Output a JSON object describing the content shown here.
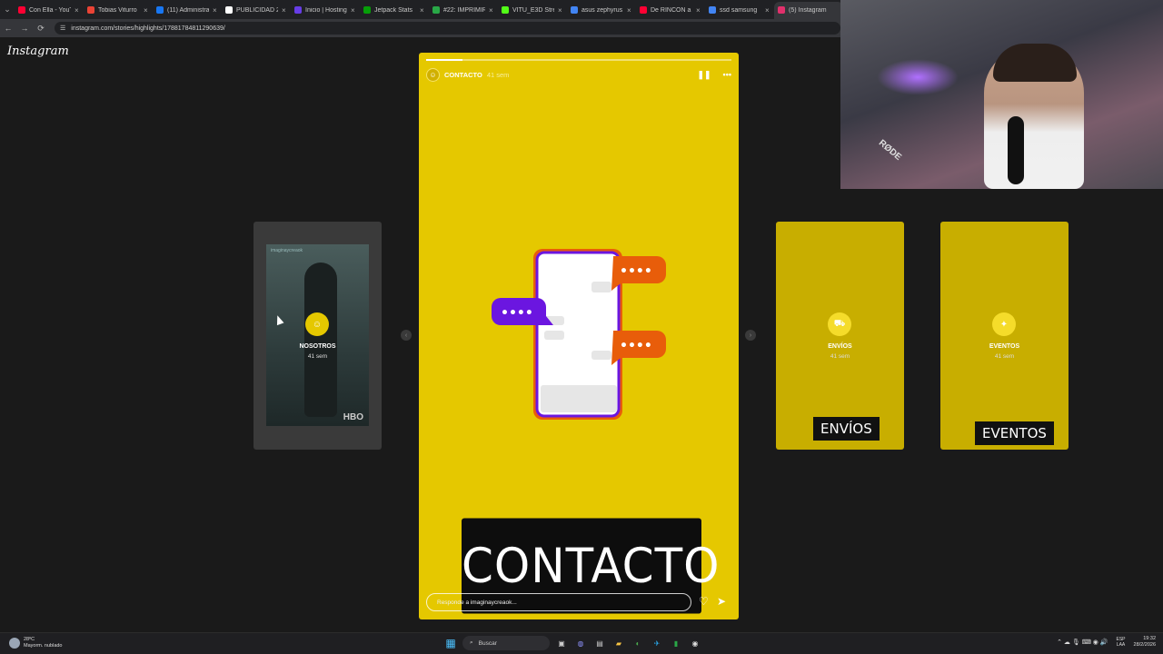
{
  "browser": {
    "tabs": [
      {
        "title": "Con Ella - YouTube",
        "color": "#ff0033"
      },
      {
        "title": "Tobias Viturro",
        "color": "#ea4335"
      },
      {
        "title": "(11) Administrar",
        "color": "#1877f2"
      },
      {
        "title": "PUBLICIDAD 2",
        "color": "#ffffff"
      },
      {
        "title": "Inicio | Hostinger",
        "color": "#673de6"
      },
      {
        "title": "Jetpack Stats",
        "color": "#069e08"
      },
      {
        "title": "#22: IMPRIMIR",
        "color": "#29a847"
      },
      {
        "title": "VITU_E3D Stre",
        "color": "#53fc18"
      },
      {
        "title": "asus zephyrus",
        "color": "#4285f4"
      },
      {
        "title": "De RINCÓN a",
        "color": "#ff0033"
      },
      {
        "title": "ssd samsung",
        "color": "#4285f4"
      },
      {
        "title": "(5) Instagram",
        "color": "#e1306c"
      }
    ],
    "url": "instagram.com/stories/highlights/17881784811290639/",
    "menu_glyph": "⌄",
    "close_glyph": "×",
    "back_glyph": "←",
    "forward_glyph": "→",
    "reload_glyph": "⟳",
    "info_glyph": "☰"
  },
  "instagram": {
    "logo": "Instagram",
    "left_story": {
      "name": "NOSOTROS",
      "time": "41 sem",
      "watermark": "HBO",
      "top_user": "imaginaycreaok",
      "icon": "☺"
    },
    "main_story": {
      "user": "CONTACTO",
      "time": "41 sem",
      "progress": 0.12,
      "title": "CONTACTO",
      "reply_placeholder": "Responde a imaginaycreaok...",
      "pause_glyph": "❚❚",
      "more_glyph": "•••",
      "heart_glyph": "♡",
      "send_glyph": "➤",
      "avatar_glyph": "☺",
      "bubble_dots": "••••"
    },
    "right_stories": [
      {
        "name": "ENVÍOS",
        "time": "41 sem",
        "label": "ENVÍOS",
        "icon": "⛟"
      },
      {
        "name": "EVENTOS",
        "time": "41 sem",
        "label": "EVENTOS",
        "icon": "✦"
      }
    ],
    "prev_glyph": "‹",
    "next_glyph": "›",
    "accent_yellow": "#e5c800",
    "bubble_orange": "#e85d0a",
    "bubble_purple": "#6b16e0"
  },
  "webcam": {
    "brand": "RØDE"
  },
  "taskbar": {
    "temperature": "28ºC",
    "weather": "Mayorm. nublado",
    "search": "Buscar",
    "search_glyph": "⌕",
    "language": "ESP",
    "layout": "LAA",
    "time": "19:32",
    "date": "28/2/2026",
    "tray_glyphs": "⌃ ☁ 🎙 ⌨ ◉ 🔊",
    "app_glyphs": [
      "▦",
      "▣",
      "◍",
      "▤",
      "▰",
      "◐",
      "✈",
      "▮",
      "◉"
    ]
  }
}
